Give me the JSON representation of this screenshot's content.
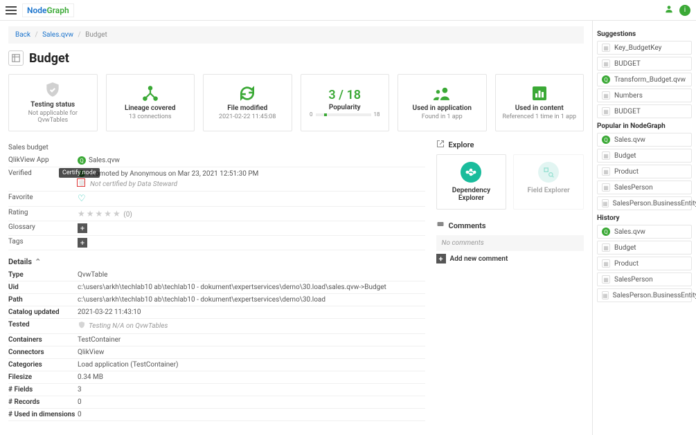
{
  "brand": {
    "node": "Node",
    "graph": "Graph"
  },
  "breadcrumbs": {
    "back": "Back",
    "mid": "Sales.qvw",
    "current": "Budget"
  },
  "page": {
    "title": "Budget"
  },
  "cards": {
    "testing": {
      "title": "Testing status",
      "sub": "Not applicable for QvwTables"
    },
    "lineage": {
      "title": "Lineage covered",
      "sub": "13 connections"
    },
    "modified": {
      "title": "File modified",
      "sub": "2021-02-22 11:45:08"
    },
    "popularity": {
      "title": "Popularity",
      "big": "3 / 18",
      "min": "0",
      "max": "18"
    },
    "usedapp": {
      "title": "Used in application",
      "sub": "Found in 1 app"
    },
    "usedcontent": {
      "title": "Used in content",
      "sub": "Referenced 1 time in 1 app"
    }
  },
  "meta": {
    "sales_budget": "Sales budget",
    "qlikview_app": {
      "label": "QlikView App",
      "value": "Sales.qvw"
    },
    "verified": {
      "label": "Verified",
      "tooltip": "Certify node",
      "promoted": "Promoted by Anonymous on Mar 23, 2021 12:51:30 PM",
      "not_certified": "Not certified by Data Steward"
    },
    "favorite": {
      "label": "Favorite"
    },
    "rating": {
      "label": "Rating",
      "count": "(0)"
    },
    "glossary": {
      "label": "Glossary"
    },
    "tags": {
      "label": "Tags"
    }
  },
  "details": {
    "header": "Details",
    "rows": {
      "type": {
        "k": "Type",
        "v": "QvwTable"
      },
      "uid": {
        "k": "Uid",
        "v": "c:\\users\\arkh\\techlab10 ab\\techlab10 - dokument\\expertservices\\demo\\30.load\\sales.qvw->Budget"
      },
      "path": {
        "k": "Path",
        "v": "c:\\users\\arkh\\techlab10 ab\\techlab10 - dokument\\expertservices\\demo\\30.load"
      },
      "catalog": {
        "k": "Catalog updated",
        "v": "2021-03-22 11:43:10"
      },
      "tested": {
        "k": "Tested",
        "v": "Testing N/A on QvwTables"
      },
      "containers": {
        "k": "Containers",
        "v": "TestContainer"
      },
      "connectors": {
        "k": "Connectors",
        "v": "QlikView"
      },
      "categories": {
        "k": "Categories",
        "v": "Load application (TestContainer)"
      },
      "filesize": {
        "k": "Filesize",
        "v": "0.34 MB"
      },
      "fields": {
        "k": "# Fields",
        "v": "3"
      },
      "records": {
        "k": "# Records",
        "v": "0"
      },
      "dims": {
        "k": "# Used in dimensions",
        "v": "0"
      }
    }
  },
  "explore": {
    "header": "Explore",
    "dep": "Dependency Explorer",
    "field": "Field Explorer"
  },
  "comments": {
    "header": "Comments",
    "empty": "No comments",
    "add": "Add new comment"
  },
  "sidebar": {
    "suggestions": {
      "title": "Suggestions",
      "items": [
        "Key_BudgetKey",
        "BUDGET",
        "Transform_Budget.qvw",
        "Numbers",
        "BUDGET"
      ]
    },
    "popular": {
      "title": "Popular in NodeGraph",
      "items": [
        "Sales.qvw",
        "Budget",
        "Product",
        "SalesPerson",
        "SalesPerson.BusinessEntityID"
      ]
    },
    "history": {
      "title": "History",
      "items": [
        "Sales.qvw",
        "Budget",
        "Product",
        "SalesPerson",
        "SalesPerson.BusinessEntityID"
      ]
    }
  }
}
